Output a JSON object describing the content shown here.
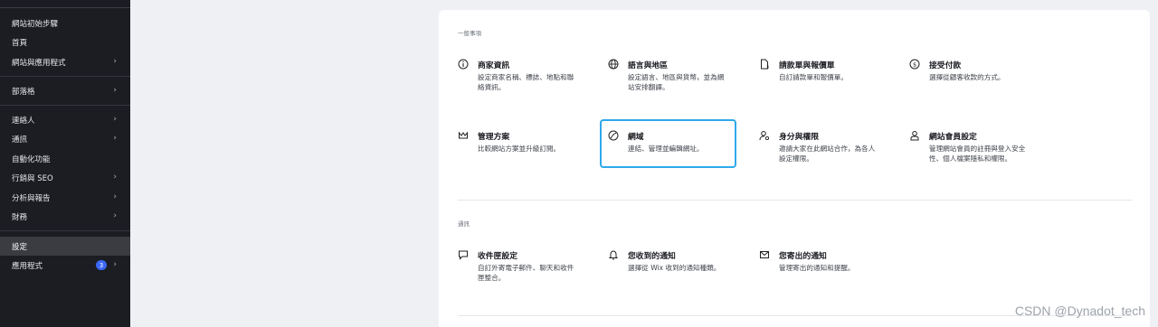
{
  "sidebar": {
    "items": [
      {
        "label": "網站初始步驟"
      },
      {
        "label": "首頁"
      },
      {
        "label": "網站與應用程式",
        "chevron": "›"
      },
      {
        "label": "部落格",
        "chevron": "›"
      },
      {
        "label": "連絡人",
        "chevron": "›"
      },
      {
        "label": "通訊",
        "chevron": "›"
      },
      {
        "label": "自動化功能"
      },
      {
        "label": "行銷與 SEO",
        "chevron": "›"
      },
      {
        "label": "分析與報告",
        "chevron": "›"
      },
      {
        "label": "財務",
        "chevron": "›"
      },
      {
        "label": "設定"
      },
      {
        "label": "應用程式",
        "chevron": "›",
        "badge": "3"
      }
    ]
  },
  "general": {
    "label": "一般事項",
    "cards": [
      {
        "title": "商家資訊",
        "desc": "設定商家名稱、標誌、地點和聯絡資訊。",
        "icon": "info-icon"
      },
      {
        "title": "語言與地區",
        "desc": "設定語言、地區與貨幣，並為網站安排翻譯。",
        "icon": "globe-icon"
      },
      {
        "title": "請款單與報價單",
        "desc": "自訂請款單和報價單。",
        "icon": "document-dollar-icon"
      },
      {
        "title": "接受付款",
        "desc": "選擇從顧客收款的方式。",
        "icon": "dollar-circle-icon"
      },
      {
        "title": "管理方案",
        "desc": "比較網站方案並升級訂閱。",
        "icon": "crown-icon"
      },
      {
        "title": "網域",
        "desc": "連結、管理並編輯網址。",
        "icon": "domain-globe-icon"
      },
      {
        "title": "身分與權限",
        "desc": "邀請大家在此網站合作，為各人設定權限。",
        "icon": "user-key-icon"
      },
      {
        "title": "網站會員設定",
        "desc": "管理網站會員的註冊與登入安全性、個人檔案隱私和權限。",
        "icon": "user-icon"
      }
    ]
  },
  "comms": {
    "label": "通訊",
    "cards": [
      {
        "title": "收件匣設定",
        "desc": "自訂外寄電子郵件、聊天和收件匣整合。",
        "icon": "chat-bubble-icon"
      },
      {
        "title": "您收到的通知",
        "desc": "選擇從 Wix 收到的通知種類。",
        "icon": "bell-icon"
      },
      {
        "title": "您寄出的通知",
        "desc": "管理寄出的通知和提醒。",
        "icon": "envelope-icon"
      }
    ]
  },
  "watermark": "CSDN @Dynadot_tech",
  "colors": {
    "accent": "#2fa8ec",
    "sidebar_bg": "#1b1d22",
    "badge": "#3b66f5"
  }
}
